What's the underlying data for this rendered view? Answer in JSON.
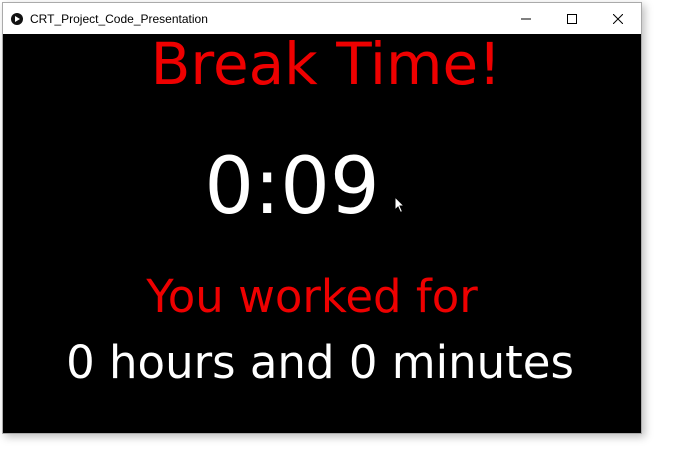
{
  "window": {
    "title": "CRT_Project_Code_Presentation",
    "controls": {
      "minimize_icon": "minimize-icon",
      "maximize_icon": "maximize-icon",
      "close_icon": "close-icon"
    }
  },
  "screen": {
    "heading": "Break Time!",
    "timer": "0:09",
    "worked_label": "You worked for",
    "worked_duration": "0 hours and 0 minutes"
  },
  "colors": {
    "background": "#000000",
    "accent_red": "#ee0000",
    "text_white": "#ffffff"
  }
}
